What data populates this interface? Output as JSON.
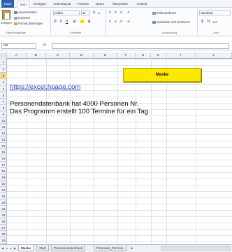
{
  "ribbon": {
    "tabs": [
      "Datei",
      "Start",
      "Einfügen",
      "Seitenlayout",
      "Formeln",
      "Daten",
      "Überprüfen",
      "Ansicht"
    ],
    "clipboard": {
      "paste_label": "Einfügen",
      "cut_label": "Ausschneiden",
      "copy_label": "Kopieren",
      "format_painter_label": "Format übertragen",
      "group_label": "Zwischenablage"
    },
    "font": {
      "name": "Calibri",
      "size": "11",
      "group_label": "Schriftart",
      "bold": "F",
      "italic": "K",
      "underline": "U"
    },
    "alignment": {
      "wrap_text_label": "Zeilenumbruch",
      "merge_label": "Verbinden und zentrieren",
      "group_label": "Ausrichtung"
    },
    "number": {
      "format": "Standard",
      "group_label": "Zahl"
    }
  },
  "formula_bar": {
    "cell_ref": "N3",
    "fx": "fx",
    "content": ""
  },
  "grid": {
    "columns": [
      "A",
      "B",
      "C",
      "D",
      "E",
      "F",
      "G",
      "H",
      "I",
      "J"
    ],
    "rows": [
      "1",
      "2",
      "3",
      "4",
      "5",
      "6",
      "7",
      "8",
      "9",
      "10",
      "11",
      "12",
      "13",
      "14",
      "15",
      "16",
      "17",
      "18",
      "19",
      "20",
      "21",
      "22",
      "23",
      "24",
      "25",
      "26",
      "27",
      "28",
      "29"
    ]
  },
  "sheet": {
    "button_label": "Maske",
    "link": "https://excel.hpage.com",
    "line1": "Personendatenbank hat 4000 Personen Nr.",
    "line2": "Das Programm erstellt 100 Termine für ein Tag"
  },
  "sheet_tabs": [
    "Maske",
    "Start",
    "Personendatenbank",
    "Personen_Termine"
  ],
  "colors": {
    "accent": "#2b62ae",
    "button_yellow": "#fde800",
    "link": "#1f3fbf",
    "row_highlight": "#f5d780"
  }
}
